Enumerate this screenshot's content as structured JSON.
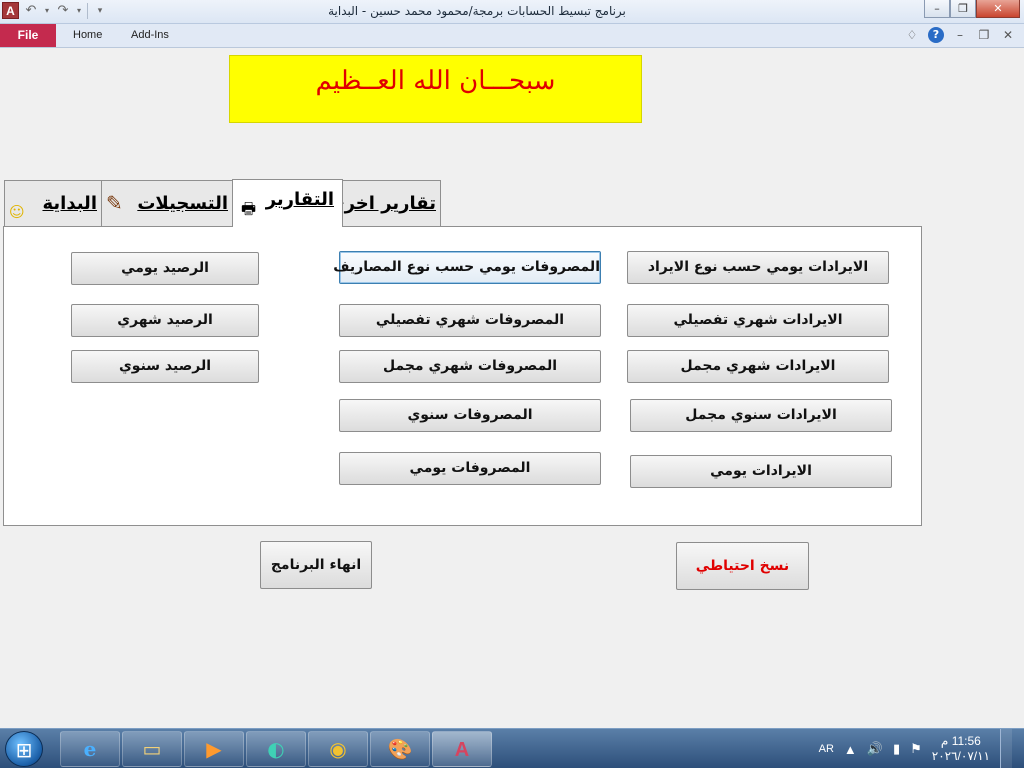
{
  "window": {
    "app_logo": "A",
    "title": "برنامج تبسيط الحسابات برمجة/محمود محمد حسين - البداية",
    "controls": {
      "minimize": "–",
      "restore": "❐",
      "close": "✕"
    }
  },
  "ribbon": {
    "file": "File",
    "tabs": [
      "Home",
      "Add-Ins"
    ]
  },
  "banner": {
    "text": "سبحـــان الله العــظيم"
  },
  "form_tabs": [
    {
      "label": "تقارير اخرى"
    },
    {
      "label": "التقارير"
    },
    {
      "label": "التسجيلات"
    },
    {
      "label": "البداية"
    }
  ],
  "buttons": {
    "revenue_daily_by_type": "الايرادات يومي حسب نوع الايراد",
    "revenue_monthly_detailed": "الايرادات شهري تفصيلي",
    "revenue_monthly_total": "الايرادات شهري مجمل",
    "revenue_yearly_total": "الايرادات سنوي مجمل",
    "revenue_daily": "الايرادات يومي",
    "expenses_daily_by_type": "المصروفات يومي حسب نوع المصاريف",
    "expenses_monthly_detailed": "المصروفات شهري تفصيلي",
    "expenses_monthly_total": "المصروفات شهري مجمل",
    "expenses_yearly": "المصروفات سنوي",
    "expenses_daily": "المصروفات يومي",
    "balance_daily": "الرصيد يومي",
    "balance_monthly": "الرصيد شهري",
    "balance_yearly": "الرصيد سنوي",
    "backup": "نسخ احتياطي",
    "exit": "انهاء البرنامج"
  },
  "taskbar": {
    "apps": [
      "internet-explorer",
      "file-explorer",
      "media-player",
      "edge",
      "chrome",
      "paint",
      "access"
    ],
    "tray": {
      "language": "AR",
      "time": "11:56 م",
      "date": "٢٠٢٦/٠٧/١١"
    }
  },
  "colors": {
    "banner_bg": "#ffff00",
    "banner_text": "#e00000",
    "file_tab": "#c42a4e",
    "backup_text": "#e00000"
  }
}
